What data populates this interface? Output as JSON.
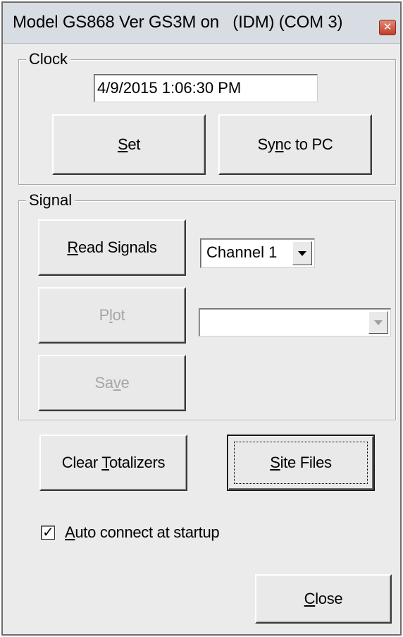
{
  "window": {
    "title": "Model GS868 Ver GS3M on   (IDM) (COM 3)"
  },
  "clock": {
    "legend": "Clock",
    "datetime": "4/9/2015 1:06:30 PM",
    "set_button": {
      "before": "",
      "mnemonic": "S",
      "after": "et"
    },
    "sync_button": {
      "before": "Sy",
      "mnemonic": "n",
      "after": "c to PC"
    }
  },
  "signal": {
    "legend": "Signal",
    "read_button": {
      "before": "",
      "mnemonic": "R",
      "after": "ead Signals"
    },
    "plot_button": {
      "before": "P",
      "mnemonic": "l",
      "after": "ot"
    },
    "save_button": {
      "before": "Sa",
      "mnemonic": "v",
      "after": "e"
    },
    "channel_select": {
      "value": "Channel 1"
    },
    "plot_select": {
      "value": ""
    }
  },
  "actions": {
    "clear_totalizers_button": {
      "before": "Clear ",
      "mnemonic": "T",
      "after": "otalizers"
    },
    "site_files_button": {
      "before": "",
      "mnemonic": "S",
      "after": "ite Files"
    }
  },
  "auto_connect": {
    "checked": true,
    "label": {
      "before": "",
      "mnemonic": "A",
      "after": "uto connect at startup"
    }
  },
  "close_button": {
    "before": "",
    "mnemonic": "C",
    "after": "lose"
  },
  "icons": {
    "close": "close-icon",
    "dropdown": "chevron-down-icon",
    "check": "checkmark-icon"
  }
}
